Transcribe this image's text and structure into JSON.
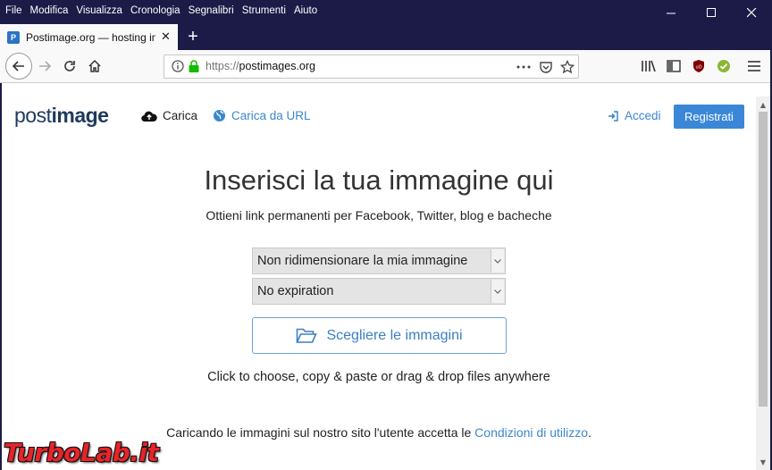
{
  "browser": {
    "menu": [
      "File",
      "Modifica",
      "Visualizza",
      "Cronologia",
      "Segnalibri",
      "Strumenti",
      "Aiuto"
    ],
    "tab_title": "Postimage.org — hosting imma",
    "favicon_letter": "P",
    "url_protocol": "https://",
    "url_host": "postimages.org",
    "window_controls": [
      "minimize-icon",
      "maximize-icon",
      "close-icon"
    ]
  },
  "site": {
    "logo_light": "post",
    "logo_bold": "image",
    "nav": {
      "carica": "Carica",
      "carica_url": "Carica da URL",
      "accedi": "Accedi",
      "registrati": "Registrati"
    },
    "headline": "Inserisci la tua immagine qui",
    "subheadline": "Ottieni link permanenti per Facebook, Twitter, blog e bacheche",
    "resize_select": "Non ridimensionare la mia immagine",
    "expiration_select": "No expiration",
    "choose_button": "Scegliere le immagini",
    "hint": "Click to choose, copy & paste or drag & drop files anywhere",
    "terms_prefix": "Caricando le immagini sul nostro sito l'utente accetta le ",
    "terms_link": "Condizioni di utilizzo",
    "terms_suffix": "."
  },
  "colors": {
    "titlebar": "#1c1b48",
    "accent": "#3a87d8",
    "link": "#3b87cc"
  },
  "watermark": "TurboLab.it"
}
